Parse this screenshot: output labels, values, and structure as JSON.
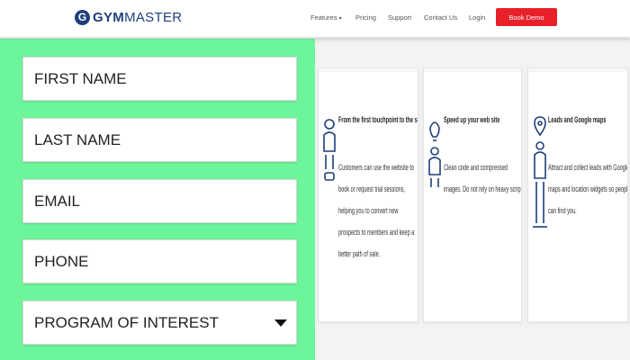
{
  "header": {
    "logo": {
      "mark": "G",
      "gym": "GYM",
      "master": "MASTER"
    },
    "nav": {
      "features": "Features",
      "features_caret": "▾",
      "pricing": "Pricing",
      "support": "Support",
      "contact": "Contact Us",
      "login": "Login",
      "book_demo": "Book Demo"
    }
  },
  "form": {
    "first_name": "FIRST NAME",
    "last_name": "LAST NAME",
    "email": "EMAIL",
    "phone": "PHONE",
    "program": "PROGRAM OF INTEREST"
  },
  "cards": [
    {
      "icon": "person-feedback-icon",
      "title": "From the first touchpoint to the sale",
      "body": "Customers can use the website to book or request trial sessions, helping you to convert new prospects to members and keep a better path of sale."
    },
    {
      "icon": "lightbulb-person-icon",
      "title": "Speed up your web site",
      "body": "Clean code and compressed images. Do not rely on heavy scripts."
    },
    {
      "icon": "map-pin-person-icon",
      "title": "Leads and Google maps",
      "body": "Attract and collect leads with Google maps and location widgets so people can find you."
    }
  ],
  "colors": {
    "form_bg": "#6cf59a",
    "brand": "#1f3f7a",
    "demo_button": "#e8202a"
  }
}
